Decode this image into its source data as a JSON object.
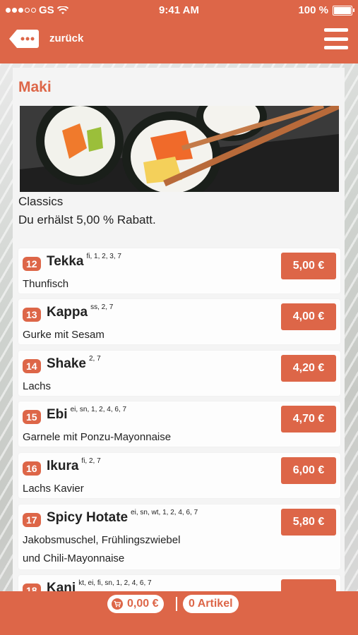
{
  "status_bar": {
    "carrier": "GS",
    "time": "9:41 AM",
    "battery": "100 %"
  },
  "header": {
    "back_label": "zurück"
  },
  "category": {
    "title": "Maki",
    "subtitle": "Classics",
    "discount": "Du erhälst 5,00 % Rabatt."
  },
  "items": [
    {
      "num": "12",
      "name": "Tekka",
      "allergens": "fi, 1, 2, 3, 7",
      "desc": "Thunfisch",
      "price": "5,00 €"
    },
    {
      "num": "13",
      "name": "Kappa",
      "allergens": "ss, 2, 7",
      "desc": "Gurke mit Sesam",
      "price": "4,00 €"
    },
    {
      "num": "14",
      "name": "Shake",
      "allergens": "2, 7",
      "desc": "Lachs",
      "price": "4,20 €"
    },
    {
      "num": "15",
      "name": "Ebi",
      "allergens": "ei, sn, 1, 2, 4, 6, 7",
      "desc": "Garnele mit Ponzu-Mayonnaise",
      "price": "4,70 €"
    },
    {
      "num": "16",
      "name": "Ikura",
      "allergens": "fi, 2, 7",
      "desc": "Lachs Kavier",
      "price": "6,00 €"
    },
    {
      "num": "17",
      "name": "Spicy Hotate",
      "allergens": "ei, sn, wt, 1, 2, 4, 6, 7",
      "desc_line1": "Jakobsmuschel, Frühlingszwiebel",
      "desc_line2": "und Chili-Mayonnaise",
      "price": "5,80 €"
    },
    {
      "num": "18",
      "name": "Kani",
      "allergens": "kt, ei, fi, sn, 1, 2, 4, 6, 7"
    }
  ],
  "footer": {
    "cart_total": "0,00 €",
    "article_count": "0 Artikel"
  },
  "colors": {
    "accent": "#dd6648"
  }
}
